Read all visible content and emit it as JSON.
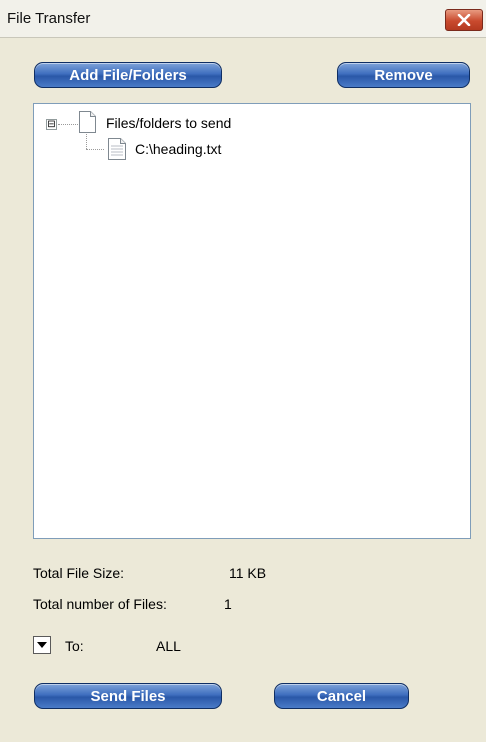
{
  "window": {
    "title": "File Transfer",
    "close_icon": "close-icon"
  },
  "toolbar": {
    "add_label": "Add File/Folders",
    "remove_label": "Remove"
  },
  "tree": {
    "root_label": "Files/folders to send",
    "root_expander": "⊟",
    "items": [
      {
        "label": "C:\\heading.txt",
        "icon": "text-file-icon"
      }
    ]
  },
  "info": {
    "total_size_label": "Total File Size:",
    "total_size_value": "11 KB",
    "total_files_label": "Total number of Files:",
    "total_files_value": "1",
    "to_label": "To:",
    "to_value": "ALL"
  },
  "footer": {
    "send_label": "Send Files",
    "cancel_label": "Cancel"
  },
  "colors": {
    "dialog_bg": "#ECE9D8",
    "button_blue": "#3F6FBF",
    "close_red": "#C94A2E"
  }
}
